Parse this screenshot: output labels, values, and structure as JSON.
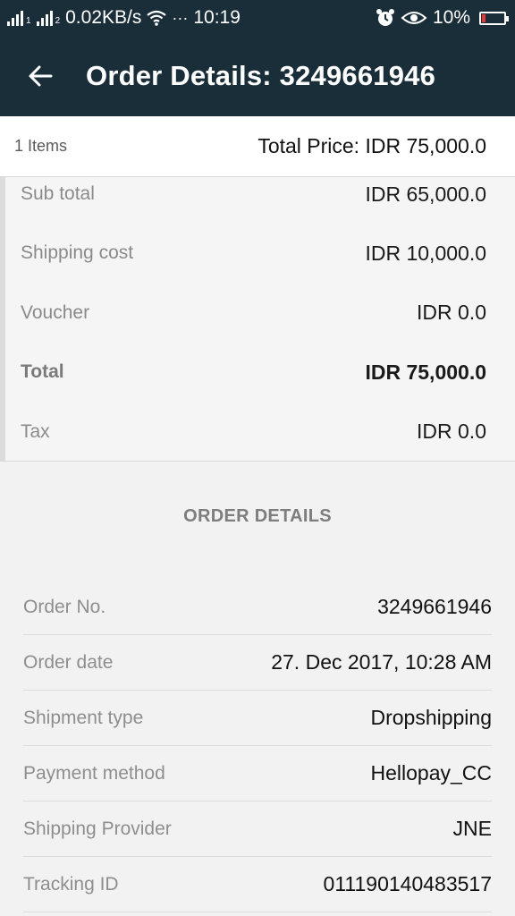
{
  "status_bar": {
    "speed": "0.02KB/s",
    "dots": "···",
    "time": "10:19",
    "battery": "10%",
    "battery_color": "#e53935",
    "icons": [
      "signal-icon",
      "signal-icon",
      "wifi-icon",
      "alarm-icon",
      "eye-icon",
      "battery-icon"
    ]
  },
  "app_bar": {
    "title": "Order Details: 3249661946",
    "back_icon": "arrow-left-icon"
  },
  "summary": {
    "items_count": "1 Items",
    "total_price": "Total Price: IDR 75,000.0"
  },
  "breakdown": [
    {
      "label": "Sub total",
      "value": "IDR 65,000.0"
    },
    {
      "label": "Shipping cost",
      "value": "IDR 10,000.0"
    },
    {
      "label": "Voucher",
      "value": "IDR 0.0"
    },
    {
      "label": "Total",
      "value": "IDR 75,000.0"
    },
    {
      "label": "Tax",
      "value": "IDR 0.0"
    }
  ],
  "order_details": {
    "title": "ORDER DETAILS",
    "rows": [
      {
        "label": "Order No.",
        "value": "3249661946"
      },
      {
        "label": "Order date",
        "value": "27. Dec 2017, 10:28 AM"
      },
      {
        "label": "Shipment type",
        "value": "Dropshipping"
      },
      {
        "label": "Payment method",
        "value": "Hellopay_CC"
      },
      {
        "label": "Shipping Provider",
        "value": "JNE"
      },
      {
        "label": "Tracking ID",
        "value": "011190140483517"
      }
    ]
  },
  "colors": {
    "header_bg": "#1a2e3a",
    "page_bg": "#f2f2f2"
  }
}
